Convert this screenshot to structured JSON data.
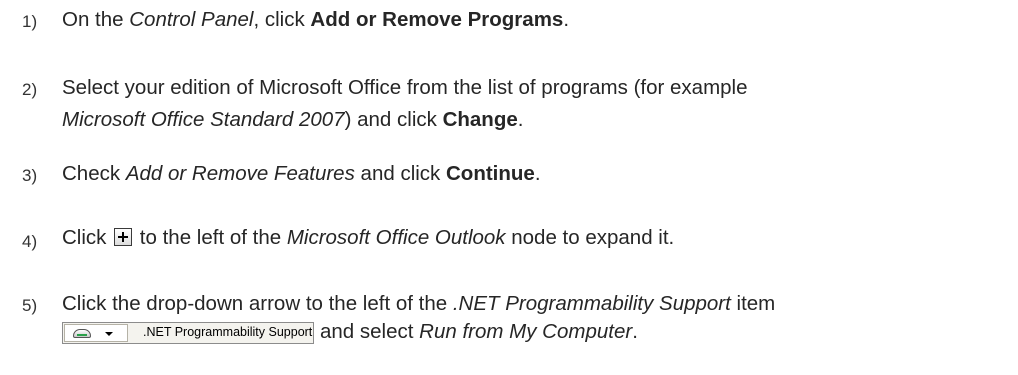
{
  "steps": [
    {
      "number": "1)",
      "parts": [
        "On the ",
        "Control Panel",
        ", click ",
        "Add or Remove Programs",
        "."
      ]
    },
    {
      "number": "2)",
      "line1": "Select your edition of Microsoft Office from the list of programs (for example",
      "line2_parts": [
        "Microsoft Office Standard 2007",
        ") and click ",
        "Change",
        "."
      ]
    },
    {
      "number": "3)",
      "parts": [
        "Check ",
        "Add or Remove Features",
        " and click ",
        "Continue",
        "."
      ]
    },
    {
      "number": "4)",
      "before_icon": "Click ",
      "after_icon_parts": [
        " to the left of the ",
        "Microsoft Office Outlook",
        " node to expand it."
      ]
    },
    {
      "number": "5)",
      "line1_parts": [
        "Click the drop-down arrow to the left of the ",
        ".NET Programmability Support",
        " item"
      ],
      "widget_label": ".NET Programmability Support",
      "line2_parts": [
        "and select ",
        "Run from My Computer",
        "."
      ]
    }
  ]
}
